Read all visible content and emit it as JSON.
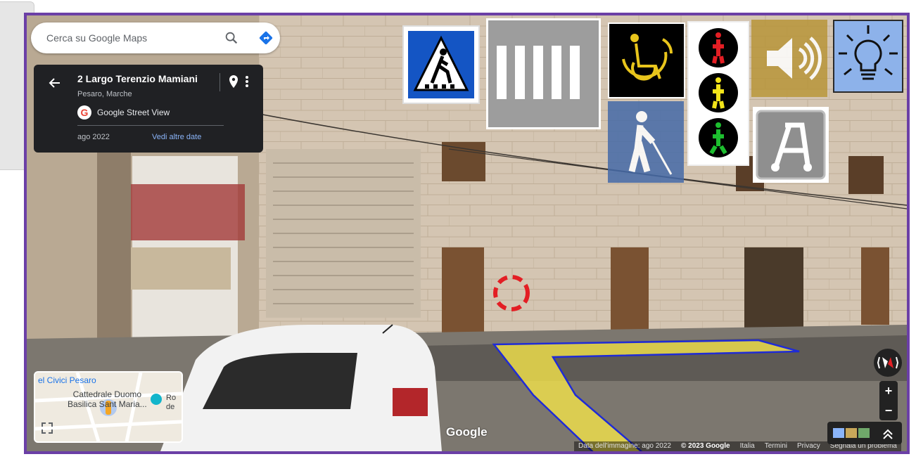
{
  "search": {
    "placeholder": "Cerca su Google Maps"
  },
  "card": {
    "title": "2 Largo Terenzio Mamiani",
    "subtitle": "Pesaro, Marche",
    "source": "Google Street View",
    "date": "ago 2022",
    "more_dates_link": "Vedi altre date"
  },
  "minimap": {
    "label_top": "el Civici Pesaro",
    "label_cathedral_1": "Cattedrale Duomo",
    "label_cathedral_2": "Basilica Sant Maria...",
    "label_side": "Ro de"
  },
  "branding": {
    "logo": "Google"
  },
  "footer": {
    "image_date": "Data dell'immagine: ago 2022",
    "copyright": "© 2023 Google",
    "country": "Italia",
    "terms": "Termini",
    "privacy": "Privacy",
    "report": "Segnala un problema"
  },
  "icons": [
    "crosswalk-sign-icon",
    "zebra-crossing-icon",
    "wheelchair-icon",
    "blind-cane-icon",
    "pedestrian-traffic-light-icon",
    "audio-signal-icon",
    "walker-icon",
    "lightbulb-icon"
  ],
  "colors": {
    "frame": "#6b3fa6",
    "tactile_path": "#f0e04a",
    "tactile_outline": "#1f2bd6",
    "target_circle": "#e31e24"
  }
}
